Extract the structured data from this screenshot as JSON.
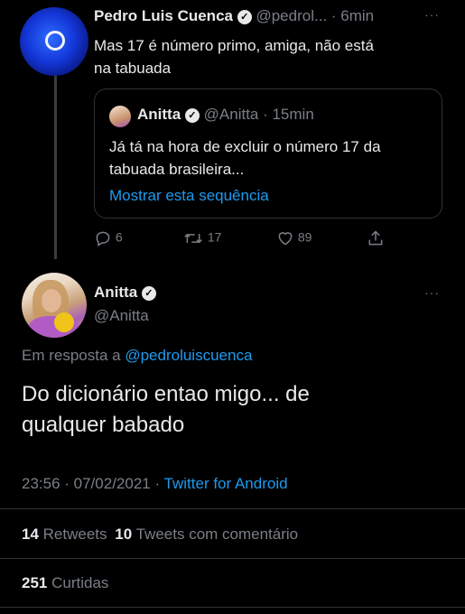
{
  "reply_tweet": {
    "author_name": "Pedro Luis Cuenca",
    "handle_time": "@pedrol... · 6min",
    "text_line1": "Mas 17 é número primo, amiga, não está",
    "text_line2": "na tabuada",
    "quote": {
      "author_name": "Anitta",
      "handle_time": "@Anitta · 15min",
      "text_line1": "Já tá na hora de excluir o número 17 da",
      "text_line2": "tabuada brasileira...",
      "show_thread": "Mostrar esta sequência"
    },
    "actions": {
      "replies": "6",
      "retweets": "17",
      "likes": "89"
    }
  },
  "main_tweet": {
    "author_name": "Anitta",
    "handle": "@Anitta",
    "reply_prefix": "Em resposta a",
    "reply_to": "@pedroluiscuenca",
    "text_line1": "Do dicionário entao migo... de",
    "text_line2": "qualquer babado",
    "timestamp": "23:56 · 07/02/2021 ·",
    "source": "Twitter for Android",
    "stats": {
      "retweets_count": "14",
      "retweets_label": "Retweets",
      "quotes_count": "10",
      "quotes_label": "Tweets com comentário",
      "likes_count": "251",
      "likes_label": "Curtidas"
    }
  },
  "icons": [
    "verified-icon",
    "more-icon",
    "reply-icon",
    "retweet-icon",
    "like-icon",
    "share-icon"
  ],
  "colors": {
    "background": "#000000",
    "link": "#1d9bf0",
    "muted": "#7a7f86",
    "text": "#e7e9ea"
  }
}
